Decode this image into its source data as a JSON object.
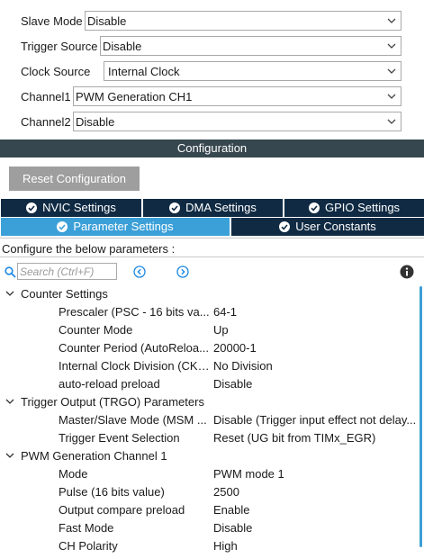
{
  "mode": {
    "slave_mode": {
      "label": "Slave Mode",
      "value": "Disable"
    },
    "trigger_source": {
      "label": "Trigger Source",
      "value": "Disable"
    },
    "clock_source": {
      "label": "Clock Source",
      "value": "Internal Clock"
    },
    "channel1": {
      "label": "Channel1",
      "value": "PWM Generation CH1"
    },
    "channel2": {
      "label": "Channel2",
      "value": "Disable"
    }
  },
  "configuration": {
    "title": "Configuration",
    "reset_button": "Reset Configuration"
  },
  "tabs": {
    "nvic": "NVIC Settings",
    "dma": "DMA Settings",
    "gpio": "GPIO Settings",
    "parameter": "Parameter Settings",
    "user_constants": "User Constants",
    "active": "parameter"
  },
  "params_hint": "Configure the below parameters :",
  "search": {
    "placeholder": "Search (Ctrl+F)"
  },
  "groups": [
    {
      "label": "Counter Settings",
      "params": [
        {
          "name": "Prescaler (PSC - 16 bits va...",
          "value": "64-1"
        },
        {
          "name": "Counter Mode",
          "value": "Up"
        },
        {
          "name": "Counter Period (AutoReloa...",
          "value": "20000-1"
        },
        {
          "name": "Internal Clock Division (CKD)",
          "value": "No Division"
        },
        {
          "name": "auto-reload preload",
          "value": "Disable"
        }
      ]
    },
    {
      "label": "Trigger Output (TRGO) Parameters",
      "params": [
        {
          "name": "Master/Slave Mode (MSM ...",
          "value": "Disable (Trigger input effect not delay..."
        },
        {
          "name": "Trigger Event Selection",
          "value": "Reset (UG bit from TIMx_EGR)"
        }
      ]
    },
    {
      "label": "PWM Generation Channel 1",
      "params": [
        {
          "name": "Mode",
          "value": "PWM mode 1"
        },
        {
          "name": "Pulse (16 bits value)",
          "value": "2500"
        },
        {
          "name": "Output compare preload",
          "value": "Enable"
        },
        {
          "name": "Fast Mode",
          "value": "Disable"
        },
        {
          "name": "CH Polarity",
          "value": "High"
        }
      ]
    }
  ],
  "colors": {
    "header_bar": "#37474f",
    "tab_dark": "#102a43",
    "tab_active": "#3ca0d8",
    "reset_button": "#9e9e9e"
  }
}
